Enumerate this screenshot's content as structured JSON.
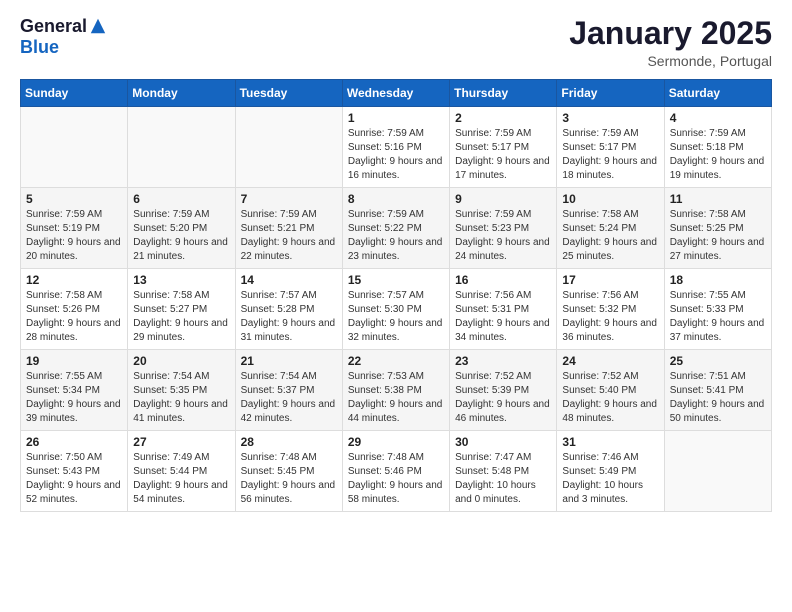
{
  "logo": {
    "general": "General",
    "blue": "Blue"
  },
  "header": {
    "month": "January 2025",
    "location": "Sermonde, Portugal"
  },
  "weekdays": [
    "Sunday",
    "Monday",
    "Tuesday",
    "Wednesday",
    "Thursday",
    "Friday",
    "Saturday"
  ],
  "weeks": [
    [
      {
        "day": "",
        "sunrise": "",
        "sunset": "",
        "daylight": ""
      },
      {
        "day": "",
        "sunrise": "",
        "sunset": "",
        "daylight": ""
      },
      {
        "day": "",
        "sunrise": "",
        "sunset": "",
        "daylight": ""
      },
      {
        "day": "1",
        "sunrise": "Sunrise: 7:59 AM",
        "sunset": "Sunset: 5:16 PM",
        "daylight": "Daylight: 9 hours and 16 minutes."
      },
      {
        "day": "2",
        "sunrise": "Sunrise: 7:59 AM",
        "sunset": "Sunset: 5:17 PM",
        "daylight": "Daylight: 9 hours and 17 minutes."
      },
      {
        "day": "3",
        "sunrise": "Sunrise: 7:59 AM",
        "sunset": "Sunset: 5:17 PM",
        "daylight": "Daylight: 9 hours and 18 minutes."
      },
      {
        "day": "4",
        "sunrise": "Sunrise: 7:59 AM",
        "sunset": "Sunset: 5:18 PM",
        "daylight": "Daylight: 9 hours and 19 minutes."
      }
    ],
    [
      {
        "day": "5",
        "sunrise": "Sunrise: 7:59 AM",
        "sunset": "Sunset: 5:19 PM",
        "daylight": "Daylight: 9 hours and 20 minutes."
      },
      {
        "day": "6",
        "sunrise": "Sunrise: 7:59 AM",
        "sunset": "Sunset: 5:20 PM",
        "daylight": "Daylight: 9 hours and 21 minutes."
      },
      {
        "day": "7",
        "sunrise": "Sunrise: 7:59 AM",
        "sunset": "Sunset: 5:21 PM",
        "daylight": "Daylight: 9 hours and 22 minutes."
      },
      {
        "day": "8",
        "sunrise": "Sunrise: 7:59 AM",
        "sunset": "Sunset: 5:22 PM",
        "daylight": "Daylight: 9 hours and 23 minutes."
      },
      {
        "day": "9",
        "sunrise": "Sunrise: 7:59 AM",
        "sunset": "Sunset: 5:23 PM",
        "daylight": "Daylight: 9 hours and 24 minutes."
      },
      {
        "day": "10",
        "sunrise": "Sunrise: 7:58 AM",
        "sunset": "Sunset: 5:24 PM",
        "daylight": "Daylight: 9 hours and 25 minutes."
      },
      {
        "day": "11",
        "sunrise": "Sunrise: 7:58 AM",
        "sunset": "Sunset: 5:25 PM",
        "daylight": "Daylight: 9 hours and 27 minutes."
      }
    ],
    [
      {
        "day": "12",
        "sunrise": "Sunrise: 7:58 AM",
        "sunset": "Sunset: 5:26 PM",
        "daylight": "Daylight: 9 hours and 28 minutes."
      },
      {
        "day": "13",
        "sunrise": "Sunrise: 7:58 AM",
        "sunset": "Sunset: 5:27 PM",
        "daylight": "Daylight: 9 hours and 29 minutes."
      },
      {
        "day": "14",
        "sunrise": "Sunrise: 7:57 AM",
        "sunset": "Sunset: 5:28 PM",
        "daylight": "Daylight: 9 hours and 31 minutes."
      },
      {
        "day": "15",
        "sunrise": "Sunrise: 7:57 AM",
        "sunset": "Sunset: 5:30 PM",
        "daylight": "Daylight: 9 hours and 32 minutes."
      },
      {
        "day": "16",
        "sunrise": "Sunrise: 7:56 AM",
        "sunset": "Sunset: 5:31 PM",
        "daylight": "Daylight: 9 hours and 34 minutes."
      },
      {
        "day": "17",
        "sunrise": "Sunrise: 7:56 AM",
        "sunset": "Sunset: 5:32 PM",
        "daylight": "Daylight: 9 hours and 36 minutes."
      },
      {
        "day": "18",
        "sunrise": "Sunrise: 7:55 AM",
        "sunset": "Sunset: 5:33 PM",
        "daylight": "Daylight: 9 hours and 37 minutes."
      }
    ],
    [
      {
        "day": "19",
        "sunrise": "Sunrise: 7:55 AM",
        "sunset": "Sunset: 5:34 PM",
        "daylight": "Daylight: 9 hours and 39 minutes."
      },
      {
        "day": "20",
        "sunrise": "Sunrise: 7:54 AM",
        "sunset": "Sunset: 5:35 PM",
        "daylight": "Daylight: 9 hours and 41 minutes."
      },
      {
        "day": "21",
        "sunrise": "Sunrise: 7:54 AM",
        "sunset": "Sunset: 5:37 PM",
        "daylight": "Daylight: 9 hours and 42 minutes."
      },
      {
        "day": "22",
        "sunrise": "Sunrise: 7:53 AM",
        "sunset": "Sunset: 5:38 PM",
        "daylight": "Daylight: 9 hours and 44 minutes."
      },
      {
        "day": "23",
        "sunrise": "Sunrise: 7:52 AM",
        "sunset": "Sunset: 5:39 PM",
        "daylight": "Daylight: 9 hours and 46 minutes."
      },
      {
        "day": "24",
        "sunrise": "Sunrise: 7:52 AM",
        "sunset": "Sunset: 5:40 PM",
        "daylight": "Daylight: 9 hours and 48 minutes."
      },
      {
        "day": "25",
        "sunrise": "Sunrise: 7:51 AM",
        "sunset": "Sunset: 5:41 PM",
        "daylight": "Daylight: 9 hours and 50 minutes."
      }
    ],
    [
      {
        "day": "26",
        "sunrise": "Sunrise: 7:50 AM",
        "sunset": "Sunset: 5:43 PM",
        "daylight": "Daylight: 9 hours and 52 minutes."
      },
      {
        "day": "27",
        "sunrise": "Sunrise: 7:49 AM",
        "sunset": "Sunset: 5:44 PM",
        "daylight": "Daylight: 9 hours and 54 minutes."
      },
      {
        "day": "28",
        "sunrise": "Sunrise: 7:48 AM",
        "sunset": "Sunset: 5:45 PM",
        "daylight": "Daylight: 9 hours and 56 minutes."
      },
      {
        "day": "29",
        "sunrise": "Sunrise: 7:48 AM",
        "sunset": "Sunset: 5:46 PM",
        "daylight": "Daylight: 9 hours and 58 minutes."
      },
      {
        "day": "30",
        "sunrise": "Sunrise: 7:47 AM",
        "sunset": "Sunset: 5:48 PM",
        "daylight": "Daylight: 10 hours and 0 minutes."
      },
      {
        "day": "31",
        "sunrise": "Sunrise: 7:46 AM",
        "sunset": "Sunset: 5:49 PM",
        "daylight": "Daylight: 10 hours and 3 minutes."
      },
      {
        "day": "",
        "sunrise": "",
        "sunset": "",
        "daylight": ""
      }
    ]
  ]
}
